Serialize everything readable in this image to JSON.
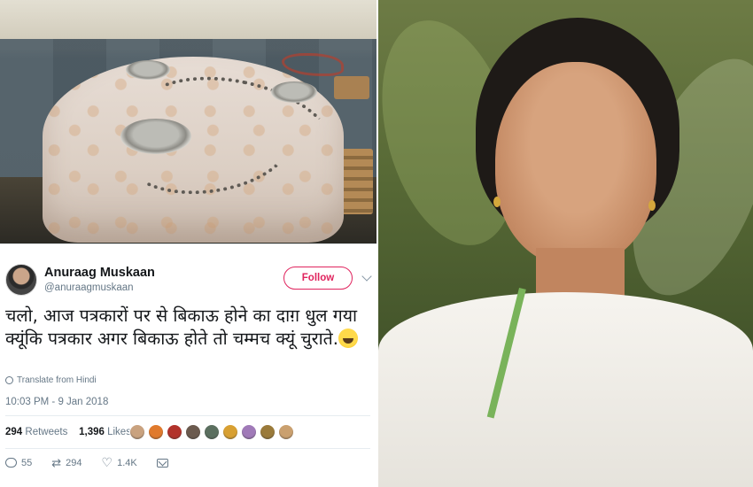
{
  "tweet": {
    "display_name": "Anuraag Muskaan",
    "handle": "@anuraagmuskaan",
    "follow_label": "Follow",
    "text": "चलो, आज पत्रकारों पर से बिकाऊ होने का दाग़ धुल गया क्यूंकि पत्रकार अगर बिकाऊ होते तो चम्मच क्यूं चुराते.",
    "translate_label": "Translate from Hindi",
    "timestamp": "10:03 PM - 9 Jan 2018",
    "retweets_count": "294",
    "retweets_label": "Retweets",
    "likes_count": "1,396",
    "likes_label": "Likes",
    "actions": {
      "replies": "55",
      "retweets": "294",
      "likes": "1.4K"
    },
    "liker_colors": [
      "#c9a27f",
      "#e07a2d",
      "#b2322b",
      "#6b5a4e",
      "#5b6f5f",
      "#d8a032",
      "#a07ab8",
      "#9a7a3a",
      "#caa06f"
    ]
  },
  "colors": {
    "follow_accent": "#e0245e",
    "secondary_text": "#657786",
    "primary_text": "#14171a"
  },
  "icons": [
    "globe-icon",
    "reply-icon",
    "retweet-icon",
    "heart-icon",
    "dm-icon",
    "chevron-down-icon"
  ]
}
